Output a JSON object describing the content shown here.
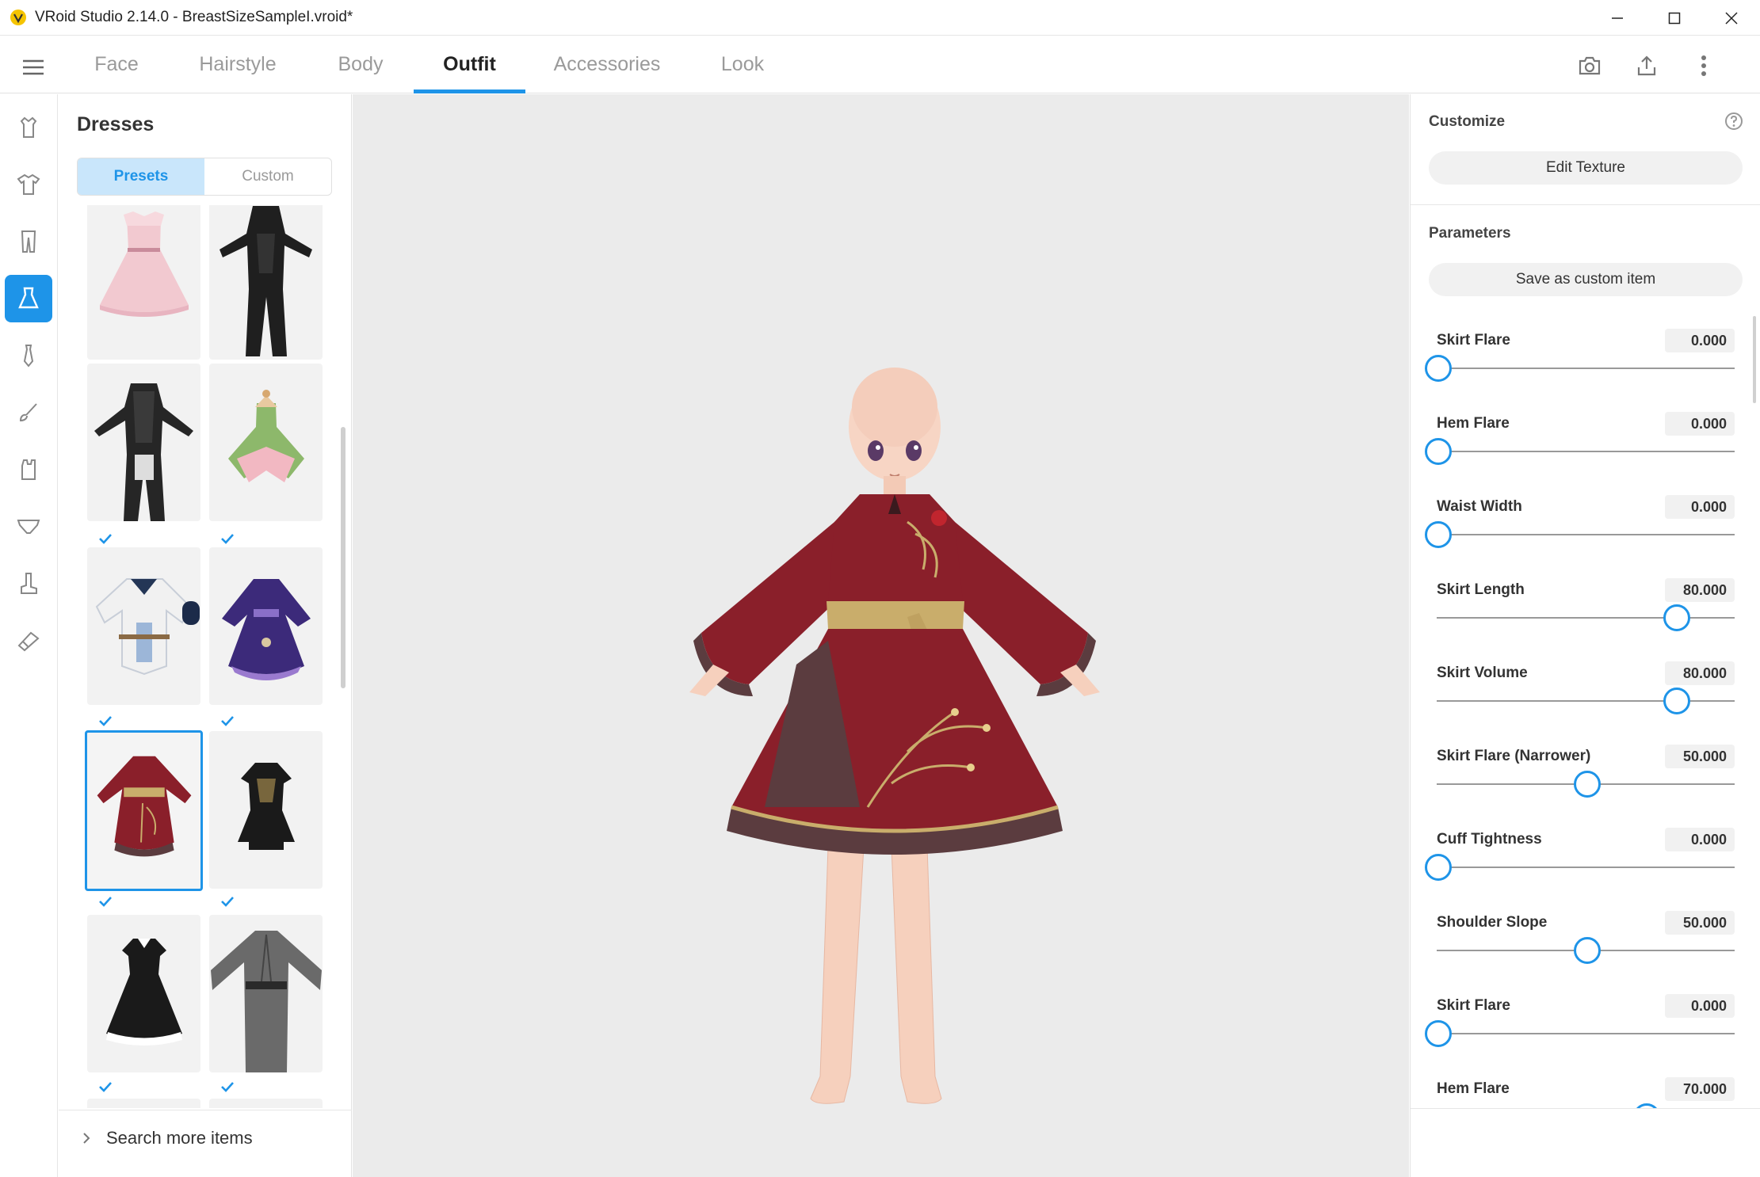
{
  "window": {
    "title": "VRoid Studio 2.14.0 - BreastSizeSampleI.vroid*"
  },
  "nav": {
    "tabs": [
      {
        "label": "Face"
      },
      {
        "label": "Hairstyle"
      },
      {
        "label": "Body"
      },
      {
        "label": "Outfit"
      },
      {
        "label": "Accessories"
      },
      {
        "label": "Look"
      }
    ],
    "active_tab": "Outfit"
  },
  "rail": {
    "items": [
      "tops-icon",
      "shirt-icon",
      "pants-icon",
      "dress-icon",
      "tie-icon",
      "brush-icon",
      "socks-icon",
      "underwear-icon",
      "boots-icon",
      "shoes-icon"
    ],
    "active": "dress-icon"
  },
  "panel": {
    "heading": "Dresses",
    "segments": {
      "presets": "Presets",
      "custom": "Custom"
    },
    "items": [
      {
        "name": "pink-dress",
        "checked": true
      },
      {
        "name": "black-bodysuit",
        "checked": true
      },
      {
        "name": "black-armor-suit",
        "checked": true
      },
      {
        "name": "flower-fairy-dress",
        "checked": true
      },
      {
        "name": "white-coat",
        "checked": true
      },
      {
        "name": "purple-kimono-dress",
        "checked": true
      },
      {
        "name": "red-qipao-dress",
        "checked": true,
        "selected": true
      },
      {
        "name": "black-gothic-dress",
        "checked": true
      },
      {
        "name": "black-maid-dress",
        "checked": true
      },
      {
        "name": "gray-robe",
        "checked": true
      }
    ],
    "search_more": "Search more items"
  },
  "right": {
    "customize_title": "Customize",
    "edit_texture": "Edit Texture",
    "parameters_title": "Parameters",
    "save_custom": "Save as custom item",
    "params": [
      {
        "label": "Skirt Flare",
        "value": "0.000",
        "fraction": 0.0
      },
      {
        "label": "Hem Flare",
        "value": "0.000",
        "fraction": 0.0
      },
      {
        "label": "Waist Width",
        "value": "0.000",
        "fraction": 0.0
      },
      {
        "label": "Skirt Length",
        "value": "80.000",
        "fraction": 0.8
      },
      {
        "label": "Skirt Volume",
        "value": "80.000",
        "fraction": 0.8
      },
      {
        "label": "Skirt Flare (Narrower)",
        "value": "50.000",
        "fraction": 0.5
      },
      {
        "label": "Cuff Tightness",
        "value": "0.000",
        "fraction": 0.0
      },
      {
        "label": "Shoulder Slope",
        "value": "50.000",
        "fraction": 0.5
      },
      {
        "label": "Skirt Flare",
        "value": "0.000",
        "fraction": 0.0
      },
      {
        "label": "Hem Flare",
        "value": "70.000",
        "fraction": 0.7
      }
    ]
  },
  "colors": {
    "accent": "#1e94e8",
    "dress_red": "#8a1f2a",
    "sash_gold": "#c9ad6b"
  }
}
